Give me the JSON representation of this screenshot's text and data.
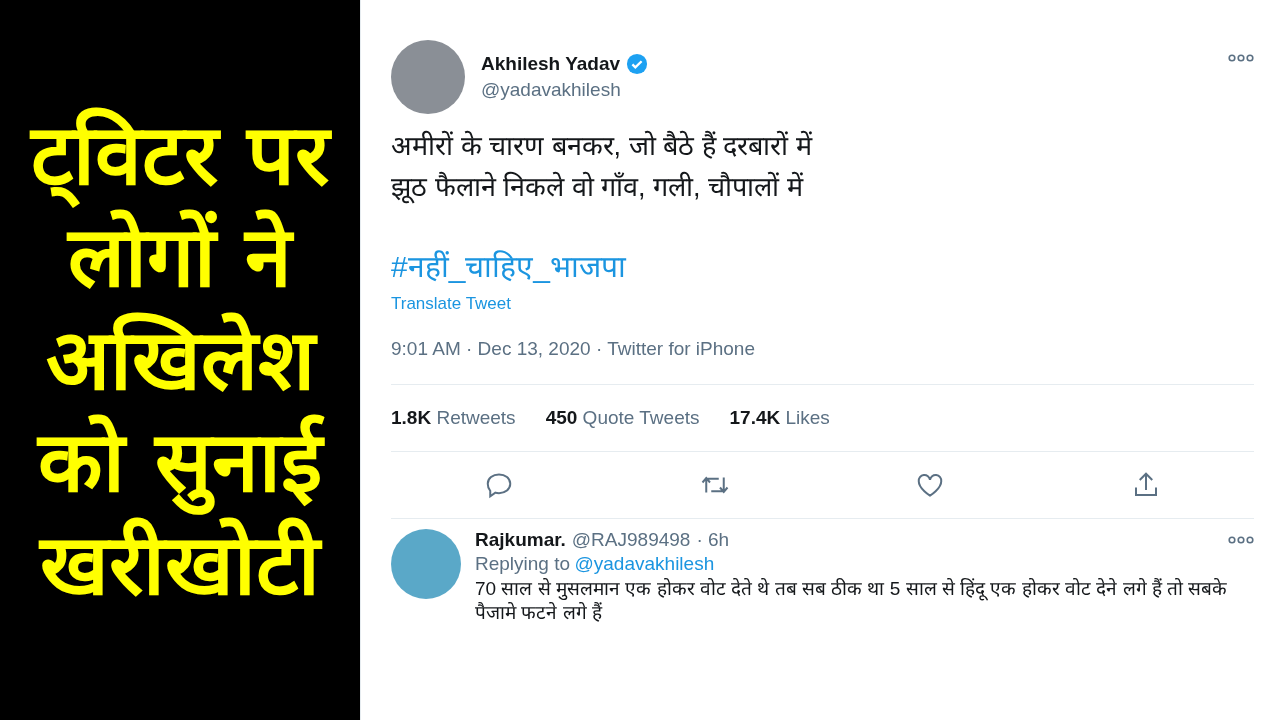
{
  "headline": "ट्विटर पर लोगों ने अखिलेश को सुनाई खरीखोटी",
  "tweet": {
    "author": "Akhilesh Yadav",
    "verified": true,
    "handle": "@yadavakhilesh",
    "text_lines": [
      "अमीरों के चारण बनकर, जो बैठे हैं दरबारों में",
      "झूठ फैलाने निकले वो गाँव, गली, चौपालों में"
    ],
    "hashtag": "#नहीं_चाहिए_भाजपा",
    "translate": "Translate Tweet",
    "meta": "9:01 AM · Dec 13, 2020 · Twitter for iPhone",
    "stats": [
      {
        "count": "1.8K",
        "label": "Retweets"
      },
      {
        "count": "450",
        "label": "Quote Tweets"
      },
      {
        "count": "17.4K",
        "label": "Likes"
      }
    ],
    "actions": [
      {
        "kind": "reply"
      },
      {
        "kind": "retweet"
      },
      {
        "kind": "like"
      },
      {
        "kind": "share"
      }
    ]
  },
  "reply": {
    "author": "Rajkumar.",
    "handle": "@RAJ989498",
    "time": "· 6h",
    "replying_label": "Replying to",
    "replying_to": "@yadavakhilesh",
    "text": "70 साल से मुसलमान एक होकर वोट देते थे तब सब ठीक था 5 साल से हिंदू एक होकर वोट देने लगे हैं तो सबके पैजामे फटने लगे हैं"
  }
}
